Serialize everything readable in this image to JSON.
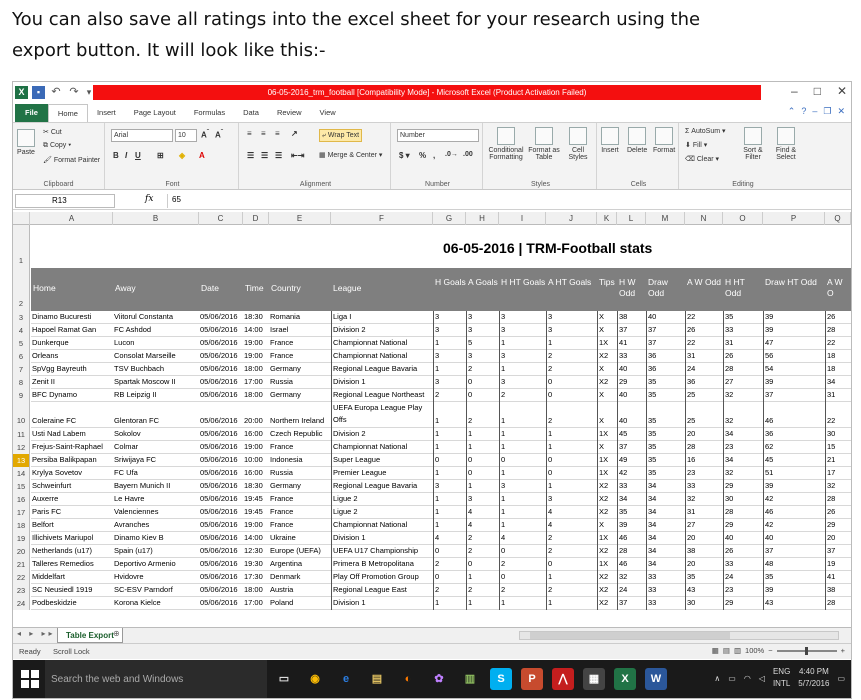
{
  "intro": {
    "line1": "You can also save all ratings into the excel sheet for your research using the",
    "line2": "export button. It will look like this:-"
  },
  "window": {
    "title": "06-05-2016_trm_football [Compatibility Mode] - Microsoft Excel (Product Activation Failed)",
    "minimize": "–",
    "restore": "□",
    "close": "✕"
  },
  "tabs": [
    "File",
    "Home",
    "Insert",
    "Page Layout",
    "Formulas",
    "Data",
    "Review",
    "View"
  ],
  "ribbon": {
    "clipboard": {
      "label": "Clipboard",
      "paste": "Paste",
      "cut": "Cut",
      "copy": "Copy",
      "format_painter": "Format Painter"
    },
    "font": {
      "label": "Font",
      "name": "Arial",
      "size": "10"
    },
    "alignment": {
      "label": "Alignment",
      "wrap": "Wrap Text",
      "merge": "Merge & Center"
    },
    "number": {
      "label": "Number",
      "format": "Number"
    },
    "styles": {
      "label": "Styles",
      "conditional": "Conditional Formatting",
      "format_table": "Format as Table",
      "cell_styles": "Cell Styles"
    },
    "cells": {
      "label": "Cells",
      "insert": "Insert",
      "delete": "Delete",
      "format": "Format"
    },
    "editing": {
      "label": "Editing",
      "autosum": "AutoSum",
      "fill": "Fill",
      "clear": "Clear",
      "sort": "Sort & Filter",
      "find": "Find & Select"
    }
  },
  "formula_bar": {
    "name_box": "R13",
    "fx": "fx",
    "value": "65"
  },
  "columns": [
    "A",
    "B",
    "C",
    "D",
    "E",
    "F",
    "G",
    "H",
    "I",
    "J",
    "K",
    "L",
    "M",
    "N",
    "O",
    "P",
    "Q"
  ],
  "sheet_title": "06-05-2016 | TRM-Football stats",
  "headers": [
    "Home",
    "Away",
    "Date",
    "Time",
    "Country",
    "League",
    "H Goals",
    "A Goals",
    "H HT Goals",
    "A HT Goals",
    "Tips",
    "H W Odd",
    "Draw Odd",
    "A W Odd",
    "H HT Odd",
    "Draw HT Odd",
    "A W O"
  ],
  "rows": [
    {
      "n": "3",
      "c": [
        "Dinamo Bucuresti",
        "Viitorul Constanta",
        "05/06/2016",
        "18:30",
        "Romania",
        "Liga I",
        "3",
        "3",
        "3",
        "3",
        "X",
        "38",
        "40",
        "22",
        "35",
        "39",
        "26"
      ]
    },
    {
      "n": "4",
      "c": [
        "Hapoel Ramat Gan",
        "FC Ashdod",
        "05/06/2016",
        "14:00",
        "Israel",
        "Division 2",
        "3",
        "3",
        "3",
        "3",
        "X",
        "37",
        "37",
        "26",
        "33",
        "39",
        "28"
      ]
    },
    {
      "n": "5",
      "c": [
        "Dunkerque",
        "Lucon",
        "05/06/2016",
        "19:00",
        "France",
        "Championnat National",
        "1",
        "5",
        "1",
        "1",
        "1X",
        "41",
        "37",
        "22",
        "31",
        "47",
        "22"
      ]
    },
    {
      "n": "6",
      "c": [
        "Orleans",
        "Consolat Marseille",
        "05/06/2016",
        "19:00",
        "France",
        "Championnat National",
        "3",
        "3",
        "3",
        "2",
        "X2",
        "33",
        "36",
        "31",
        "26",
        "56",
        "18"
      ]
    },
    {
      "n": "7",
      "c": [
        "SpVgg Bayreuth",
        "TSV Buchbach",
        "05/06/2016",
        "18:00",
        "Germany",
        "Regional League Bavaria",
        "1",
        "2",
        "1",
        "2",
        "X",
        "40",
        "36",
        "24",
        "28",
        "54",
        "18"
      ]
    },
    {
      "n": "8",
      "c": [
        "Zenit II",
        "Spartak Moscow II",
        "05/06/2016",
        "17:00",
        "Russia",
        "Division 1",
        "3",
        "0",
        "3",
        "0",
        "X2",
        "29",
        "35",
        "36",
        "27",
        "39",
        "34"
      ]
    },
    {
      "n": "9",
      "c": [
        "BFC Dynamo",
        "RB Leipzig II",
        "05/06/2016",
        "18:00",
        "Germany",
        "Regional League Northeast",
        "2",
        "0",
        "2",
        "0",
        "X",
        "40",
        "35",
        "25",
        "32",
        "37",
        "31"
      ]
    },
    {
      "n": "10",
      "c": [
        "Coleraine FC",
        "Glentoran FC",
        "05/06/2016",
        "20:00",
        "Northern Ireland",
        "UEFA Europa League Play Offs",
        "1",
        "2",
        "1",
        "2",
        "X",
        "40",
        "35",
        "25",
        "32",
        "46",
        "22"
      ]
    },
    {
      "n": "11",
      "c": [
        "Usti Nad Labem",
        "Sokolov",
        "05/06/2016",
        "16:00",
        "Czech Republic",
        "Division 2",
        "1",
        "1",
        "1",
        "1",
        "1X",
        "45",
        "35",
        "20",
        "34",
        "36",
        "30"
      ]
    },
    {
      "n": "12",
      "c": [
        "Frejus-Saint-Raphael",
        "Colmar",
        "05/06/2016",
        "19:00",
        "France",
        "Championnat National",
        "1",
        "1",
        "1",
        "1",
        "X",
        "37",
        "35",
        "28",
        "23",
        "62",
        "15"
      ]
    },
    {
      "n": "13",
      "c": [
        "Persiba Balikpapan",
        "Sriwijaya FC",
        "05/06/2016",
        "10:00",
        "Indonesia",
        "Super League",
        "0",
        "0",
        "0",
        "0",
        "1X",
        "49",
        "35",
        "16",
        "34",
        "45",
        "21"
      ]
    },
    {
      "n": "14",
      "c": [
        "Krylya Sovetov",
        "FC Ufa",
        "05/06/2016",
        "16:00",
        "Russia",
        "Premier League",
        "1",
        "0",
        "1",
        "0",
        "1X",
        "42",
        "35",
        "23",
        "32",
        "51",
        "17"
      ]
    },
    {
      "n": "15",
      "c": [
        "Schweinfurt",
        "Bayern Munich II",
        "05/06/2016",
        "18:30",
        "Germany",
        "Regional League Bavaria",
        "3",
        "1",
        "3",
        "1",
        "X2",
        "33",
        "34",
        "33",
        "29",
        "39",
        "32"
      ]
    },
    {
      "n": "16",
      "c": [
        "Auxerre",
        "Le Havre",
        "05/06/2016",
        "19:45",
        "France",
        "Ligue 2",
        "1",
        "3",
        "1",
        "3",
        "X2",
        "34",
        "34",
        "32",
        "30",
        "42",
        "28"
      ]
    },
    {
      "n": "17",
      "c": [
        "Paris FC",
        "Valenciennes",
        "05/06/2016",
        "19:45",
        "France",
        "Ligue 2",
        "1",
        "4",
        "1",
        "4",
        "X2",
        "35",
        "34",
        "31",
        "28",
        "46",
        "26"
      ]
    },
    {
      "n": "18",
      "c": [
        "Belfort",
        "Avranches",
        "05/06/2016",
        "19:00",
        "France",
        "Championnat National",
        "1",
        "4",
        "1",
        "4",
        "X",
        "39",
        "34",
        "27",
        "29",
        "42",
        "29"
      ]
    },
    {
      "n": "19",
      "c": [
        "Illichivets Mariupol",
        "Dinamo Kiev B",
        "05/06/2016",
        "14:00",
        "Ukraine",
        "Division 1",
        "4",
        "2",
        "4",
        "2",
        "1X",
        "46",
        "34",
        "20",
        "40",
        "40",
        "20"
      ]
    },
    {
      "n": "20",
      "c": [
        "Netherlands (u17)",
        "Spain (u17)",
        "05/06/2016",
        "12:30",
        "Europe (UEFA)",
        "UEFA U17 Championship",
        "0",
        "2",
        "0",
        "2",
        "X2",
        "28",
        "34",
        "38",
        "26",
        "37",
        "37"
      ]
    },
    {
      "n": "21",
      "c": [
        "Talleres Remedios",
        "Deportivo Armenio",
        "05/06/2016",
        "19:30",
        "Argentina",
        "Primera B Metropolitana",
        "2",
        "0",
        "2",
        "0",
        "1X",
        "46",
        "34",
        "20",
        "33",
        "48",
        "19"
      ]
    },
    {
      "n": "22",
      "c": [
        "Middelfart",
        "Hvidovre",
        "05/06/2016",
        "17:30",
        "Denmark",
        "Play Off Promotion Group",
        "0",
        "1",
        "0",
        "1",
        "X2",
        "32",
        "33",
        "35",
        "24",
        "35",
        "41"
      ]
    },
    {
      "n": "23",
      "c": [
        "SC Neusiedl 1919",
        "SC-ESV Parndorf",
        "05/06/2016",
        "18:00",
        "Austria",
        "Regional League East",
        "2",
        "2",
        "2",
        "2",
        "X2",
        "24",
        "33",
        "43",
        "23",
        "39",
        "38"
      ]
    },
    {
      "n": "24",
      "c": [
        "Podbeskidzie",
        "Korona Kielce",
        "05/06/2016",
        "17:00",
        "Poland",
        "Division 1",
        "1",
        "1",
        "1",
        "1",
        "X2",
        "37",
        "33",
        "30",
        "29",
        "43",
        "28"
      ]
    }
  ],
  "sheet_tab": "Table Export",
  "status": {
    "ready": "Ready",
    "scroll": "Scroll Lock",
    "zoom": "100%"
  },
  "taskbar": {
    "search": "Search the web and Windows",
    "lang1": "ENG",
    "lang2": "INTL",
    "time": "4:40 PM",
    "date": "5/7/2016"
  },
  "colors": {
    "excel_green": "#217346",
    "title_red": "#f40f0f",
    "header_gray": "#7f7f7f",
    "selected_row": "#e2a800"
  }
}
